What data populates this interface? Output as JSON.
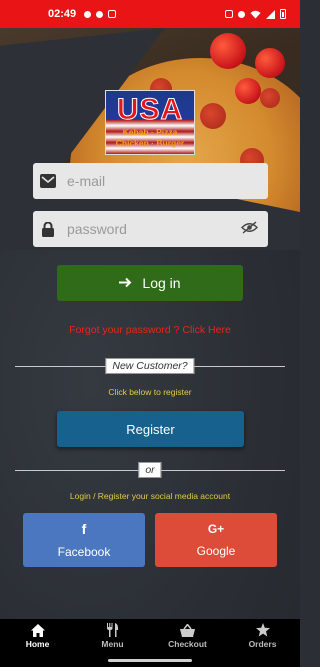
{
  "status_bar": {
    "time": "02:49"
  },
  "logo": {
    "title": "USA",
    "line1": "Kebab · Pizza",
    "line2": "Chicken · Burger"
  },
  "login": {
    "email_placeholder": "e-mail",
    "password_placeholder": "password",
    "login_label": "Log in",
    "forgot_text": "Forgot your password ? Click Here"
  },
  "register": {
    "divider_label": "New Customer?",
    "hint": "Click below to register",
    "button_label": "Register"
  },
  "social": {
    "divider_label": "or",
    "hint": "Login / Register your social media account",
    "facebook_label": "Facebook",
    "google_label": "Google",
    "facebook_icon": "f",
    "google_icon": "G+"
  },
  "nav": {
    "items": [
      {
        "label": "Home",
        "icon": "home-icon",
        "active": true
      },
      {
        "label": "Menu",
        "icon": "cutlery-icon"
      },
      {
        "label": "Checkout",
        "icon": "basket-icon"
      },
      {
        "label": "Orders",
        "icon": "star-icon"
      }
    ]
  },
  "colors": {
    "status_bar": "#e81416",
    "login_button": "#2f6b18",
    "register_button": "#17618e",
    "facebook": "#4a77c0",
    "google": "#dd4b39",
    "forgot_link": "#e4281c",
    "hint_text": "#e6c84a"
  }
}
